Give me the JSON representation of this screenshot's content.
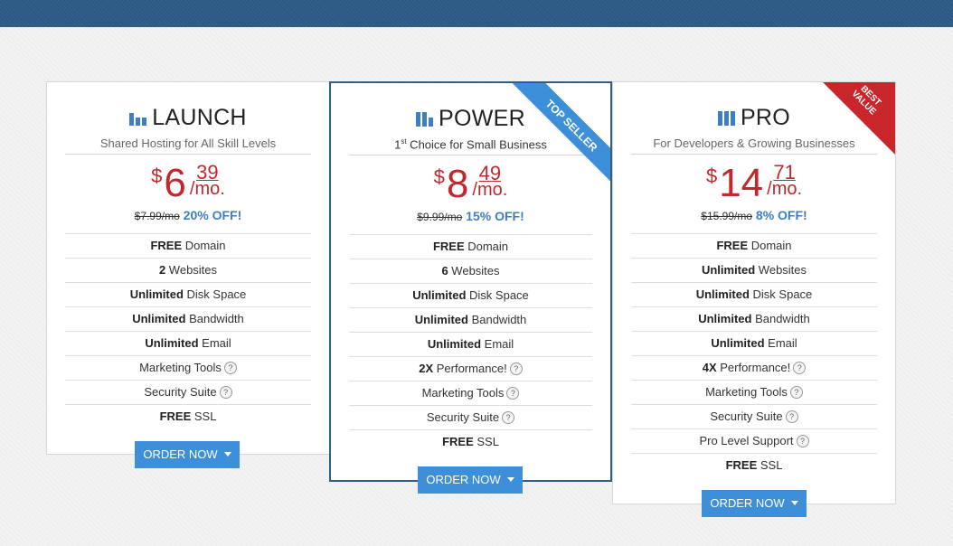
{
  "colors": {
    "accent": "#3d8fd9",
    "price": "#c0282d",
    "header": "#2a5a83",
    "badge_red": "#c9262b"
  },
  "plans": [
    {
      "name": "LAUNCH",
      "icon": "bar-chart-icon",
      "subtitle": "Shared Hosting for All Skill Levels",
      "currency": "$",
      "dollars": "6",
      "cents": "39",
      "period": "/mo.",
      "old_price": "$7.99/mo",
      "discount": "20% OFF!",
      "features": [
        {
          "bold": "FREE",
          "text": " Domain",
          "help": false
        },
        {
          "bold": "2",
          "text": " Websites",
          "help": false
        },
        {
          "bold": "Unlimited",
          "text": " Disk Space",
          "help": false
        },
        {
          "bold": "Unlimited",
          "text": " Bandwidth",
          "help": false
        },
        {
          "bold": "Unlimited",
          "text": " Email",
          "help": false
        },
        {
          "bold": "",
          "text": "Marketing Tools",
          "help": true
        },
        {
          "bold": "",
          "text": "Security Suite",
          "help": true
        },
        {
          "bold": "FREE",
          "text": " SSL",
          "help": false
        }
      ],
      "button": "ORDER NOW"
    },
    {
      "name": "POWER",
      "icon": "bar-chart-icon",
      "subtitle_pre": "1",
      "subtitle_sup": "st",
      "subtitle": " Choice for Small Business",
      "currency": "$",
      "dollars": "8",
      "cents": "49",
      "period": "/mo.",
      "old_price": "$9.99/mo",
      "discount": "15% OFF!",
      "ribbon": "TOP SELLER",
      "features": [
        {
          "bold": "FREE",
          "text": " Domain",
          "help": false
        },
        {
          "bold": "6",
          "text": " Websites",
          "help": false
        },
        {
          "bold": "Unlimited",
          "text": " Disk Space",
          "help": false
        },
        {
          "bold": "Unlimited",
          "text": " Bandwidth",
          "help": false
        },
        {
          "bold": "Unlimited",
          "text": " Email",
          "help": false
        },
        {
          "bold": "2X",
          "text": " Performance!",
          "help": true
        },
        {
          "bold": "",
          "text": "Marketing Tools",
          "help": true
        },
        {
          "bold": "",
          "text": "Security Suite",
          "help": true
        },
        {
          "bold": "FREE",
          "text": " SSL",
          "help": false
        }
      ],
      "button": "ORDER NOW"
    },
    {
      "name": "PRO",
      "icon": "bar-chart-icon",
      "subtitle": "For Developers & Growing Businesses",
      "currency": "$",
      "dollars": "14",
      "cents": "71",
      "period": "/mo.",
      "old_price": "$15.99/mo",
      "discount": "8% OFF!",
      "corner_line1": "BEST",
      "corner_line2": "VALUE",
      "features": [
        {
          "bold": "FREE",
          "text": " Domain",
          "help": false
        },
        {
          "bold": "Unlimited",
          "text": " Websites",
          "help": false
        },
        {
          "bold": "Unlimited",
          "text": " Disk Space",
          "help": false
        },
        {
          "bold": "Unlimited",
          "text": " Bandwidth",
          "help": false
        },
        {
          "bold": "Unlimited",
          "text": " Email",
          "help": false
        },
        {
          "bold": "4X",
          "text": " Performance!",
          "help": true
        },
        {
          "bold": "",
          "text": "Marketing Tools",
          "help": true
        },
        {
          "bold": "",
          "text": "Security Suite",
          "help": true
        },
        {
          "bold": "",
          "text": "Pro Level Support",
          "help": true
        },
        {
          "bold": "FREE",
          "text": " SSL",
          "help": false
        }
      ],
      "button": "ORDER NOW"
    }
  ],
  "help_glyph": "?"
}
